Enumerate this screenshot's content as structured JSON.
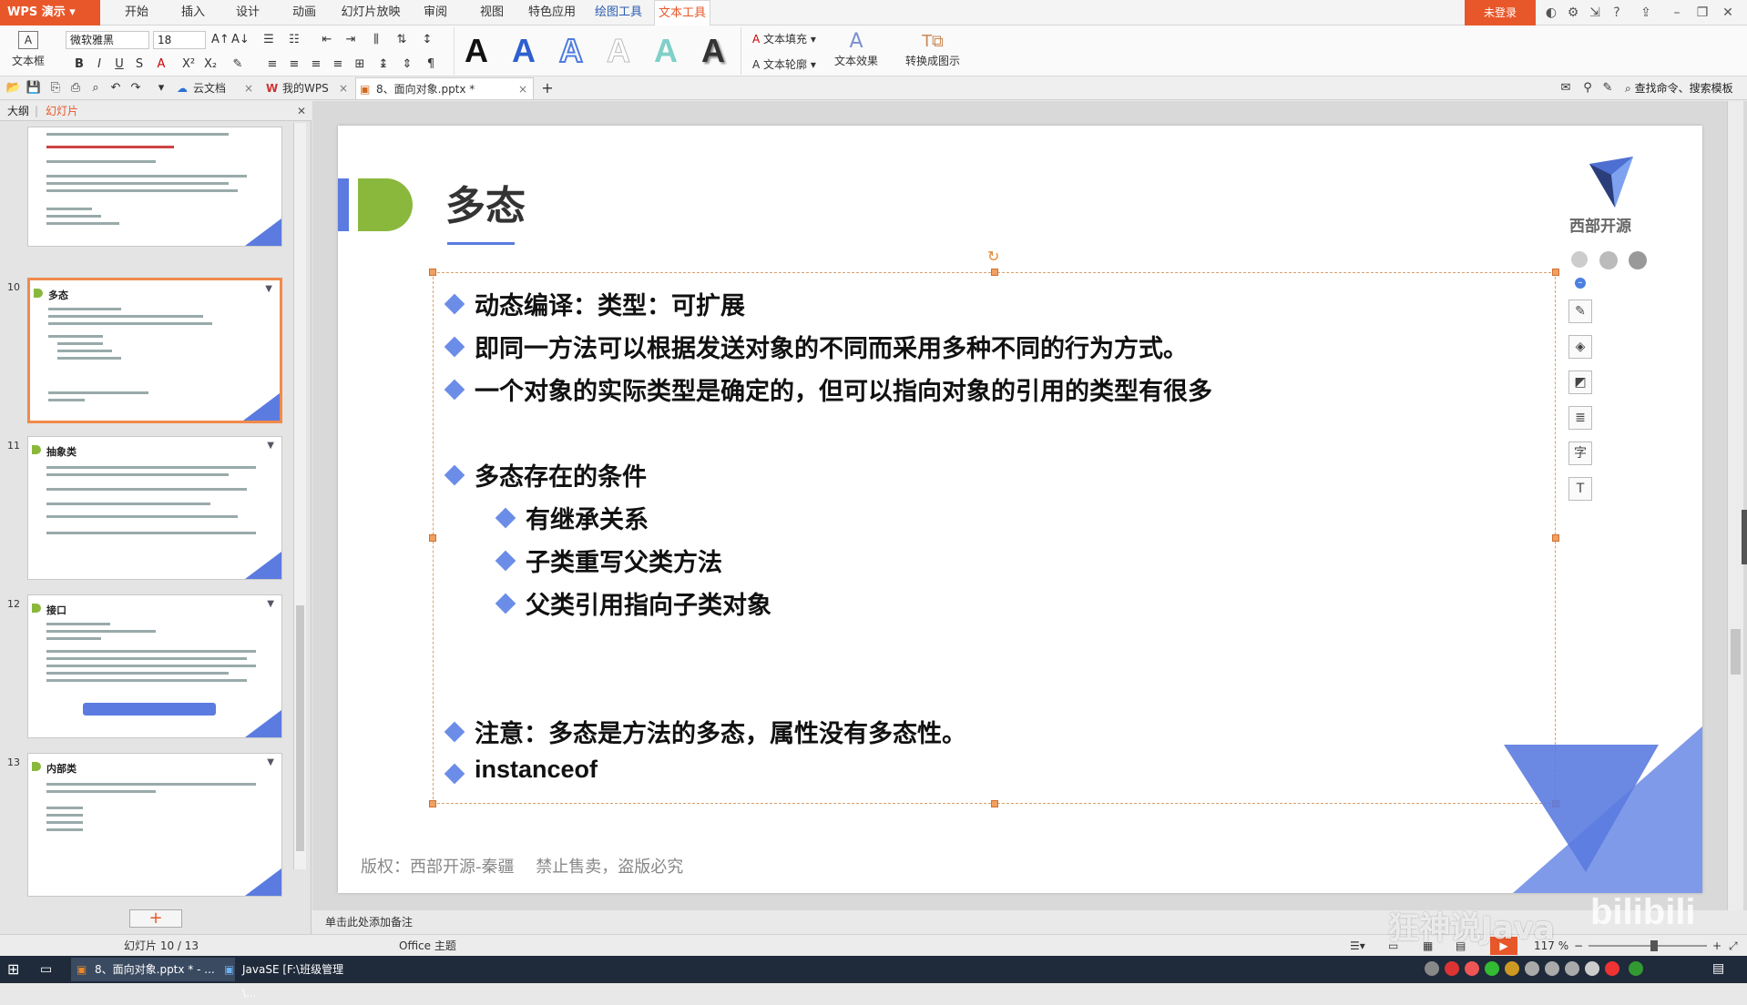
{
  "menubar": {
    "app_name": "WPS 演示",
    "items": [
      "开始",
      "插入",
      "设计",
      "动画",
      "幻灯片放映",
      "审阅",
      "视图",
      "特色应用",
      "绘图工具",
      "文本工具"
    ],
    "login_label": "未登录"
  },
  "ribbon": {
    "textbox_label": "文本框",
    "font_name": "微软雅黑",
    "font_size": "18",
    "text_fill_label": "文本填充",
    "text_outline_label": "文本轮廓",
    "text_effect_label": "文本效果",
    "convert_label": "转换成图示",
    "style_samples": [
      "A",
      "A",
      "A",
      "A",
      "A",
      "A"
    ]
  },
  "tabs": {
    "cloud_label": "云文档",
    "mywps_label": "我的WPS",
    "doc_label": "8、面向对象.pptx *",
    "search_label": "查找命令、搜索模板"
  },
  "leftpanel": {
    "outline_tab": "大纲",
    "slides_tab": "幻灯片",
    "thumbs": [
      {
        "num": "",
        "title": ""
      },
      {
        "num": "10",
        "title": "多态"
      },
      {
        "num": "11",
        "title": "抽象类"
      },
      {
        "num": "12",
        "title": "接口"
      },
      {
        "num": "13",
        "title": "内部类"
      }
    ]
  },
  "slide": {
    "title": "多态",
    "logo_text": "西部开源",
    "bullets": [
      {
        "text": "动态编译：类型：可扩展",
        "level": 1
      },
      {
        "text": "即同一方法可以根据发送对象的不同而采用多种不同的行为方式。",
        "level": 1
      },
      {
        "text": "一个对象的实际类型是确定的，但可以指向对象的引用的类型有很多",
        "level": 1
      },
      {
        "text": "多态存在的条件",
        "level": 1
      },
      {
        "text": "有继承关系",
        "level": 2
      },
      {
        "text": "子类重写父类方法",
        "level": 2
      },
      {
        "text": "父类引用指向子类对象",
        "level": 2
      },
      {
        "text": "注意：多态是方法的多态，属性没有多态性。",
        "level": 1
      },
      {
        "text": "instanceof",
        "level": 1
      }
    ],
    "footer": "版权：西部开源-秦疆　 禁止售卖，盗版必究"
  },
  "notes": {
    "placeholder": "单击此处添加备注"
  },
  "status": {
    "slide_counter": "幻灯片 10 / 13",
    "theme": "Office 主题",
    "zoom": "117 %"
  },
  "watermark": {
    "text": "狂神说Java"
  },
  "taskbar": {
    "task1": "8、面向对象.pptx * - ...",
    "task2": "JavaSE [F:\\班级管理\\..."
  },
  "colors": {
    "accent": "#e8572a",
    "bullet": "#6b8de8",
    "green": "#8ab83d",
    "triangle": "#5b7be0"
  }
}
